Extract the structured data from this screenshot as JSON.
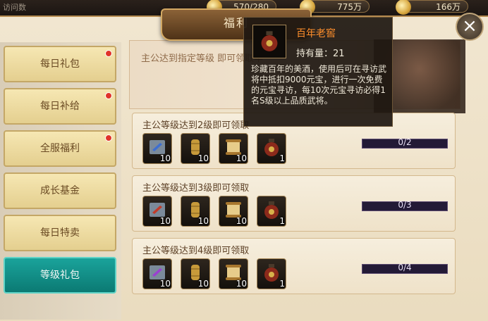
{
  "topbar": {
    "breadcrumb": "访问数",
    "resources": [
      {
        "icon": "stamina-icon",
        "value": "570/280"
      },
      {
        "icon": "gold-ingot-icon",
        "value": "775万"
      },
      {
        "icon": "coin-icon",
        "value": "166万"
      }
    ]
  },
  "window": {
    "title": "福利",
    "close_symbol": "×"
  },
  "sidebar": {
    "tabs": [
      {
        "label": "每日礼包",
        "badge": true
      },
      {
        "label": "每日补给",
        "badge": true
      },
      {
        "label": "全服福利",
        "badge": true
      },
      {
        "label": "成长基金",
        "badge": false
      },
      {
        "label": "每日特卖",
        "badge": false
      },
      {
        "label": "等级礼包",
        "badge": false,
        "active": true
      }
    ]
  },
  "banner": {
    "hint": "主公达到指定等级 即可领取丰"
  },
  "rewards": [
    {
      "label": "主公等级达到2级即可领取",
      "progress": "0/2",
      "items": [
        {
          "icon": "scroll-card-icon",
          "count": "10"
        },
        {
          "icon": "bamboo-scroll-icon",
          "count": "10"
        },
        {
          "icon": "paper-scroll-icon",
          "count": "10"
        },
        {
          "icon": "wine-jar-icon",
          "count": "1"
        }
      ]
    },
    {
      "label": "主公等级达到3级即可领取",
      "progress": "0/3",
      "items": [
        {
          "icon": "scroll-card-icon",
          "count": "10"
        },
        {
          "icon": "bamboo-scroll-icon",
          "count": "10"
        },
        {
          "icon": "paper-scroll-icon",
          "count": "10"
        },
        {
          "icon": "wine-jar-icon",
          "count": "1"
        }
      ]
    },
    {
      "label": "主公等级达到4级即可领取",
      "progress": "0/4",
      "items": [
        {
          "icon": "scroll-card-icon",
          "count": "10"
        },
        {
          "icon": "bamboo-scroll-icon",
          "count": "10"
        },
        {
          "icon": "paper-scroll-icon",
          "count": "10"
        },
        {
          "icon": "wine-jar-icon",
          "count": "1"
        }
      ]
    }
  ],
  "tooltip": {
    "icon": "wine-jar-icon",
    "name": "百年老窖",
    "held": "持有量：21",
    "description": "珍藏百年的美酒，使用后可在寻访武将中抵扣9000元宝，进行一次免费的元宝寻访，每10次元宝寻访必得1名S级以上品质武将。"
  },
  "colors": {
    "active_tab": "#0b7a73",
    "tooltip_name": "#ff8f2c",
    "badge": "#e0342a"
  }
}
